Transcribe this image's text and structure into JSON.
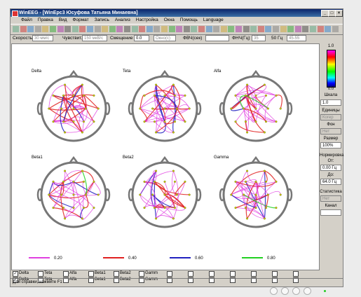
{
  "window": {
    "title": "WinEEG - [WinEpc3 Юсуфова  Татьяна  Минаевна]"
  },
  "menu": [
    "Файл",
    "Правка",
    "Вид",
    "Формат",
    "Запись",
    "Анализ",
    "Настройка",
    "Окна",
    "Помощь",
    "Language"
  ],
  "controls": {
    "speed_label": "Скорость",
    "speed_value": "30 мм/с",
    "sens_label": "Чувствит.",
    "sens_value": "150 мкВ/с",
    "offset_label": "Смещение",
    "offset_value": "0.0",
    "window_value": "Окно(с)",
    "hpf_label": "ФВЧ(сек)",
    "lpf_label": "ФНЧ(Гц)",
    "lpf_value": "35",
    "notch_label": "50 Гц",
    "notch_value": "45-55"
  },
  "maps": [
    {
      "label": "Delta"
    },
    {
      "label": "Teta"
    },
    {
      "label": "Alfa"
    },
    {
      "label": "Beta1"
    },
    {
      "label": "Beta2"
    },
    {
      "label": "Gamma"
    }
  ],
  "legend": [
    {
      "value": "0.20",
      "color": "#e040e0"
    },
    {
      "value": "0.40",
      "color": "#e02020"
    },
    {
      "value": "0.60",
      "color": "#2020c0"
    },
    {
      "value": "0.80",
      "color": "#20d020"
    }
  ],
  "sidebar": {
    "scale_top": "1.0",
    "scale_bottom": "0.0",
    "scale_label": "Шкала",
    "scale_value": "1.0",
    "units_label": "Единицы",
    "units_value": "Когер",
    "bg_label": "Фон",
    "bg_value": "Нет",
    "size_label": "Размер",
    "size_value": "100%",
    "norm_label": "Нормировка",
    "from_label": "От:",
    "from_value": "0.00 Гц",
    "to_label": "До:",
    "to_value": "64.0 Гц",
    "stats_label": "Статистика",
    "stats_value": "Нет",
    "channel_label": "Канал",
    "channel_value": ""
  },
  "checkrow1": [
    "Delta",
    "Teta",
    "Alfa",
    "Beta1",
    "Beta2",
    "Gamm"
  ],
  "checkrow2": [
    "Delta",
    "Teta",
    "Alfa",
    "Beta1",
    "Beta2",
    "Gamm"
  ],
  "status": {
    "text": "Для справки, нажмите F1"
  }
}
